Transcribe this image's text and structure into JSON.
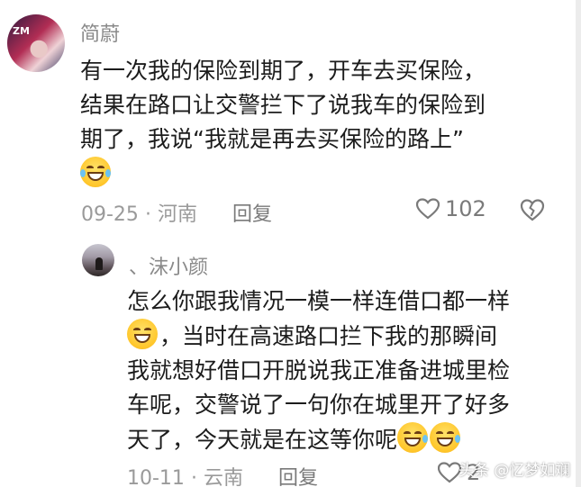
{
  "comment": {
    "avatar_tag": "ZM",
    "username": "简蔚",
    "text_lines": [
      "有一次我的保险到期了，开车去买保险，",
      "结果在路口让交警拦下了说我车的保险到",
      "期了，我说“我就是再去买保险的路上”"
    ],
    "emoji": "laughing-tears-emoji",
    "date": "09-25",
    "separator": "·",
    "location": "河南",
    "reply_label": "回复",
    "likes": "102"
  },
  "reply": {
    "username": "、沫小颜",
    "line1": "怎么你跟我情况一模一样连借口都一样",
    "line2_after_emoji": "，当时在高速路口拦下我的那瞬间",
    "line3": "我就想好借口开脱说我正准备进城里检",
    "line4": "车呢，交警说了一句你在城里开了好多",
    "line5": "天了，今天就是在这等你呢",
    "emojis": [
      "grinning-emoji",
      "grinning-sweat-emoji",
      "grinning-sweat-emoji"
    ],
    "date": "10-11",
    "separator": "·",
    "location": "云南",
    "reply_label": "回复",
    "likes": "2"
  },
  "watermark": "头条 @忆梦如斓",
  "colors": {
    "meta_gray": "#9a9a9a",
    "text": "#1c1c1c",
    "emoji_yellow": "#ffc62a"
  }
}
